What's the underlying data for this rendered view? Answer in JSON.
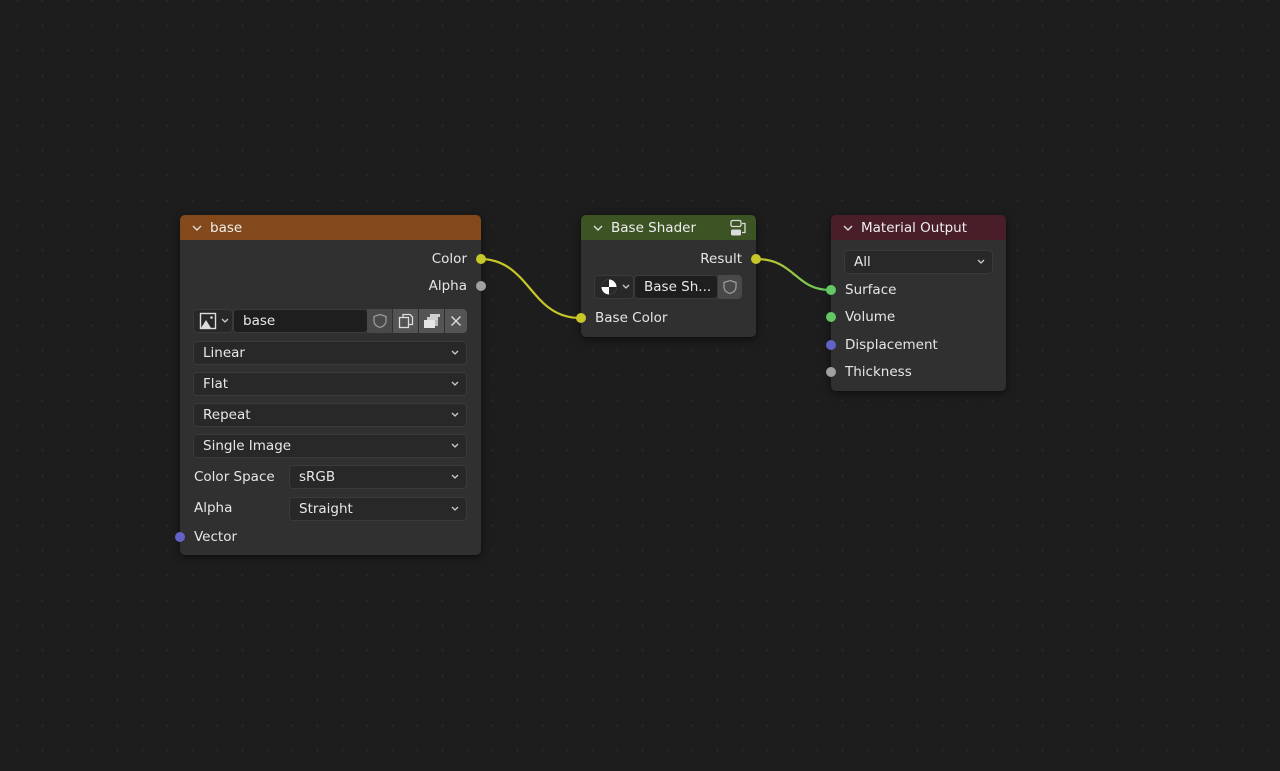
{
  "nodes": {
    "image_texture": {
      "title": "base",
      "header_color": "#83491b",
      "outputs": [
        "Color",
        "Alpha"
      ],
      "image_name": "base",
      "interpolation": "Linear",
      "projection": "Flat",
      "extension": "Repeat",
      "source": "Single Image",
      "color_space_label": "Color Space",
      "color_space": "sRGB",
      "alpha_label": "Alpha",
      "alpha_mode": "Straight",
      "inputs": [
        "Vector"
      ],
      "icons": [
        "image-icon",
        "fake-user-shield-icon",
        "duplicate-icon",
        "pack-icon",
        "close-icon"
      ]
    },
    "group": {
      "title": "Base Shader",
      "header_color": "#3c5324",
      "outputs": [
        "Result"
      ],
      "group_name": "Base Sh...",
      "inputs": [
        "Base Color"
      ]
    },
    "material_output": {
      "title": "Material Output",
      "header_color": "#4a1e28",
      "target": "All",
      "inputs": [
        "Surface",
        "Volume",
        "Displacement",
        "Thickness"
      ]
    }
  },
  "socket_colors": {
    "color": "#c7c729",
    "float": "#a1a1a1",
    "shader": "#63c763",
    "vector": "#6363c7"
  }
}
